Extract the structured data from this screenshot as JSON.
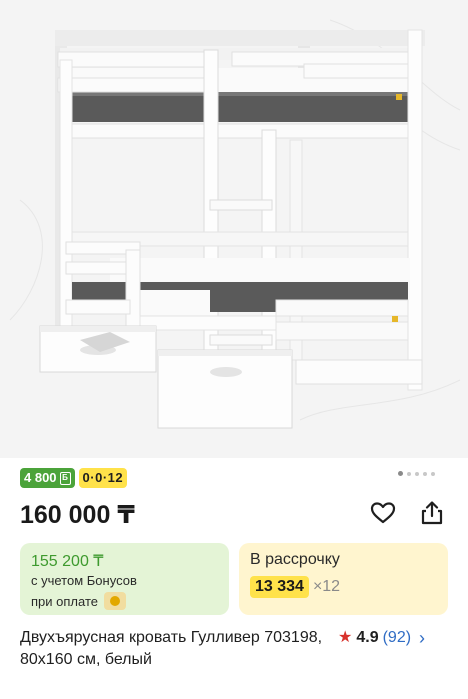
{
  "product": {
    "image_alt": "",
    "badges": {
      "bonus_label": "4 800",
      "bonus_icon": "Б",
      "installment_label": "0·0·12"
    },
    "carousel": {
      "total": 5,
      "active": 1
    },
    "price": "160 000 ₸",
    "icons": {
      "favorite": "heart-icon",
      "share": "share-icon"
    },
    "bonus_card": {
      "price": "155 200 ₸",
      "note_line1": "с учетом Бонусов",
      "note_line2": "при оплате"
    },
    "installment_card": {
      "title": "В рассрочку",
      "amount": "13 334",
      "times": "×12"
    },
    "title": "Двухъярусная кровать Гулливер 703198, 80x160 см, белый",
    "rating": {
      "score": "4.9",
      "count": "(92)"
    }
  },
  "colors": {
    "accent_green": "#4ba33a",
    "accent_yellow": "#ffe24a",
    "rating_star": "#d8322c",
    "link_blue": "#2f6cc4"
  }
}
